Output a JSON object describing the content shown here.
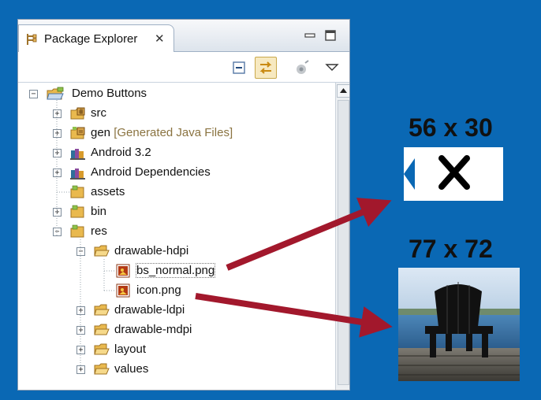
{
  "view": {
    "title": "Package Explorer",
    "close_glyph": "✕",
    "icons": {
      "tab": "package-explorer-icon",
      "minimize": "minimize-icon",
      "maximize": "maximize-icon",
      "collapse_all": "collapse-all-icon",
      "link_editor": "link-with-editor-icon",
      "view_menu": "view-menu-icon"
    }
  },
  "tree": {
    "items": [
      {
        "label": "Demo Buttons",
        "expander": "−"
      },
      {
        "label": "src",
        "expander": "+"
      },
      {
        "label": "gen",
        "decoration": "[Generated Java Files]",
        "expander": "+"
      },
      {
        "label": "Android 3.2",
        "expander": "+"
      },
      {
        "label": "Android Dependencies",
        "expander": "+"
      },
      {
        "label": "assets",
        "expander": ""
      },
      {
        "label": "bin",
        "expander": "+"
      },
      {
        "label": "res",
        "expander": "−"
      },
      {
        "label": "drawable-hdpi",
        "expander": "−"
      },
      {
        "label": "bs_normal.png",
        "expander": ""
      },
      {
        "label": "icon.png",
        "expander": ""
      },
      {
        "label": "drawable-ldpi",
        "expander": "+"
      },
      {
        "label": "drawable-mdpi",
        "expander": "+"
      },
      {
        "label": "layout",
        "expander": "+"
      },
      {
        "label": "values",
        "expander": "+"
      }
    ]
  },
  "annotations": {
    "bs_normal_size": "56 x 30",
    "icon_size": "77 x 72",
    "arrow_color": "#a2182c"
  },
  "colors": {
    "background": "#0a68b4",
    "folder": "#e9b94e",
    "selection_outline": "#777777"
  }
}
